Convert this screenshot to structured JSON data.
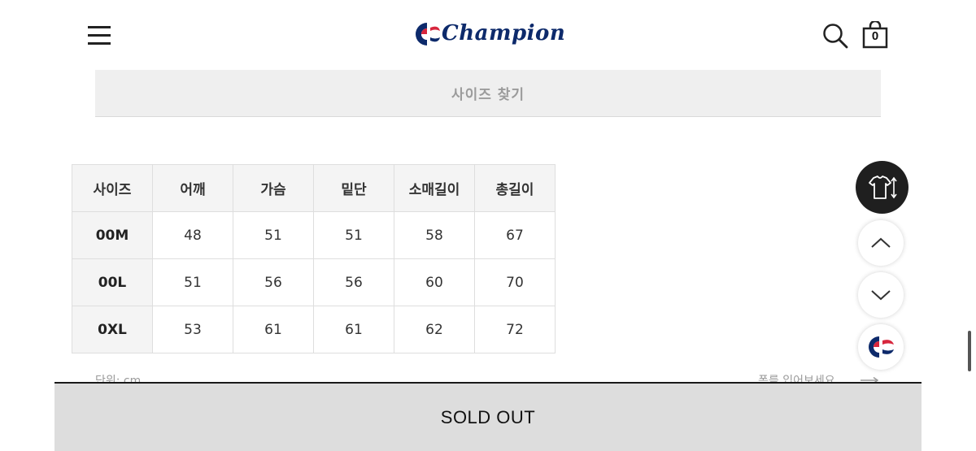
{
  "header": {
    "menu_icon": "hamburger-menu-icon",
    "logo_text": "Champion",
    "search_icon": "search-icon",
    "bag_icon": "shopping-bag-icon",
    "bag_count": "0"
  },
  "size_finder": {
    "label": "사이즈 찾기"
  },
  "size_table": {
    "headers": [
      "사이즈",
      "어깨",
      "가슴",
      "밑단",
      "소매길이",
      "총길이"
    ],
    "rows": [
      {
        "size": "00M",
        "values": [
          "48",
          "51",
          "51",
          "58",
          "67"
        ]
      },
      {
        "size": "00L",
        "values": [
          "51",
          "56",
          "56",
          "60",
          "70"
        ]
      },
      {
        "size": "0XL",
        "values": [
          "53",
          "61",
          "61",
          "62",
          "72"
        ]
      }
    ]
  },
  "notes": {
    "unit": "단위: cm",
    "fit": "폼를 입어보세요"
  },
  "floating_buttons": {
    "size_guide_icon": "shirt-size-icon",
    "scroll_up_icon": "chevron-up-icon",
    "scroll_down_icon": "chevron-down-icon",
    "brand_icon": "champion-c-logo-icon"
  },
  "soldout": {
    "label": "SOLD OUT"
  },
  "colors": {
    "logo_blue": "#0d2a6b",
    "logo_red": "#d7263d",
    "soldout_bg": "#dddddd",
    "fab_dark": "#1f1f1f"
  }
}
